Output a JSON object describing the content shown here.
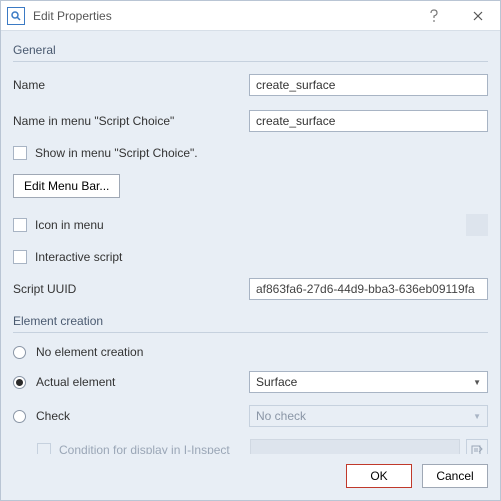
{
  "window": {
    "title": "Edit Properties"
  },
  "sections": {
    "general": "General",
    "element_creation": "Element creation"
  },
  "general": {
    "name_label": "Name",
    "name_value": "create_surface",
    "menu_name_label": "Name in menu \"Script Choice\"",
    "menu_name_value": "create_surface",
    "show_in_menu_label": "Show in menu \"Script Choice\".",
    "edit_menu_bar_label": "Edit Menu Bar...",
    "icon_in_menu_label": "Icon in menu",
    "interactive_script_label": "Interactive script",
    "script_uuid_label": "Script UUID",
    "script_uuid_value": "af863fa6-27d6-44d9-bba3-636eb09119fa"
  },
  "creation": {
    "no_element_label": "No element creation",
    "actual_element_label": "Actual element",
    "actual_element_value": "Surface",
    "check_label": "Check",
    "check_value": "No check",
    "condition_label": "Condition for display in I-Inspect"
  },
  "footer": {
    "ok": "OK",
    "cancel": "Cancel"
  }
}
